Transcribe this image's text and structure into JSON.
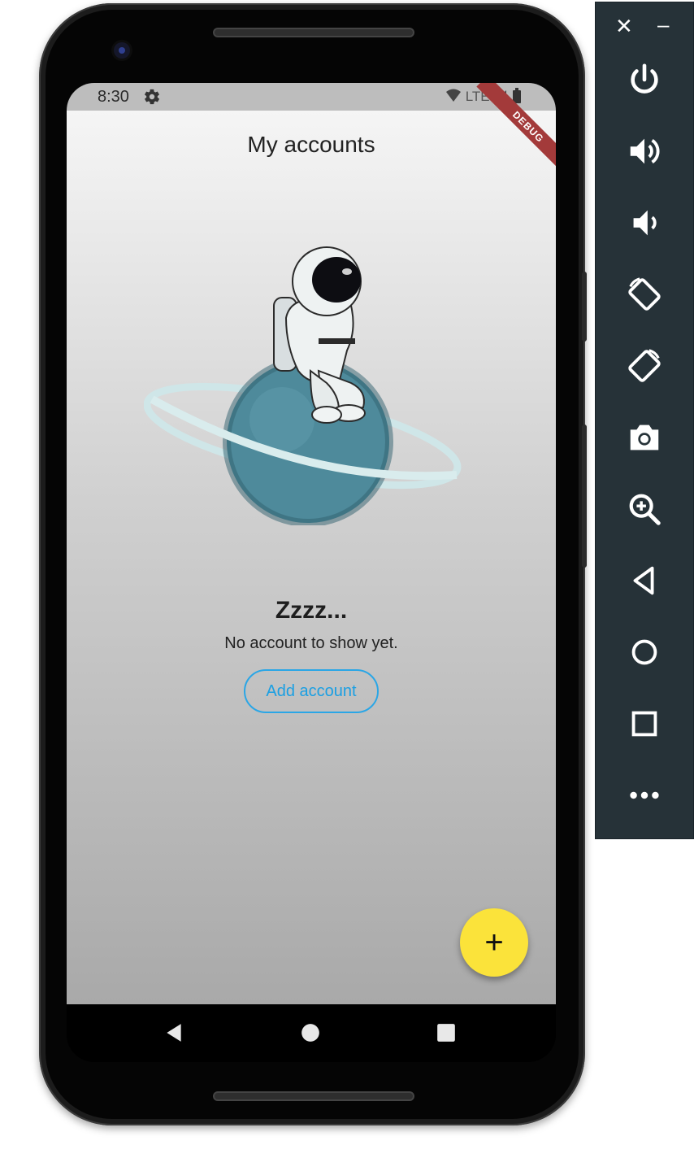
{
  "status_bar": {
    "time": "8:30",
    "network": "LTE"
  },
  "app": {
    "title": "My accounts",
    "debug_banner": "DEBUG",
    "empty_state": {
      "title": "Zzzz...",
      "message": "No account to show yet.",
      "action_label": "Add account"
    },
    "fab_label": "+"
  },
  "colors": {
    "accent": "#1a9fe3",
    "fab": "#fbe33a",
    "debug_banner": "#a33a3a",
    "toolbar_bg": "#263238",
    "planet": "#4e8a9b"
  },
  "nav_bar": {
    "icons": [
      "back-icon",
      "home-icon",
      "recents-icon"
    ]
  },
  "emulator_toolbar": {
    "close_label": "✕",
    "minimize_label": "–",
    "icons": [
      "power-icon",
      "volume-up-icon",
      "volume-down-icon",
      "rotate-left-icon",
      "rotate-right-icon",
      "camera-icon",
      "zoom-icon",
      "back-icon",
      "home-icon",
      "overview-icon",
      "more-icon"
    ]
  }
}
